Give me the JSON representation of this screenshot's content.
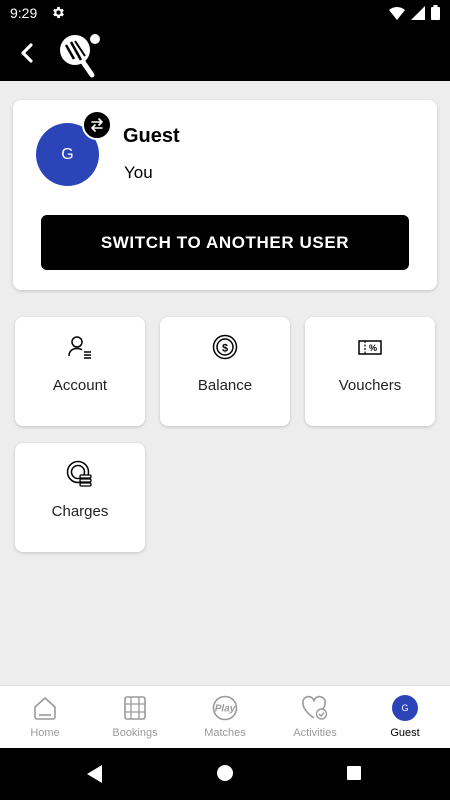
{
  "status_bar": {
    "time": "9:29"
  },
  "profile": {
    "avatar_initial": "G",
    "name": "Guest",
    "subtitle": "You",
    "switch_button_label": "SWITCH TO ANOTHER USER"
  },
  "tiles": [
    {
      "label": "Account",
      "icon": "account-icon"
    },
    {
      "label": "Balance",
      "icon": "balance-icon"
    },
    {
      "label": "Vouchers",
      "icon": "voucher-icon"
    },
    {
      "label": "Charges",
      "icon": "charges-icon"
    }
  ],
  "bottom_nav": {
    "items": [
      {
        "label": "Home",
        "icon": "home-icon"
      },
      {
        "label": "Bookings",
        "icon": "bookings-icon"
      },
      {
        "label": "Matches",
        "icon": "play-icon",
        "icon_text": "Play"
      },
      {
        "label": "Activities",
        "icon": "heart-check-icon"
      },
      {
        "label": "Guest",
        "icon": "avatar",
        "avatar_initial": "G",
        "active": true
      }
    ]
  },
  "colors": {
    "accent": "#2b44b8",
    "bar": "#000000",
    "inactive": "#9a9a9a"
  }
}
